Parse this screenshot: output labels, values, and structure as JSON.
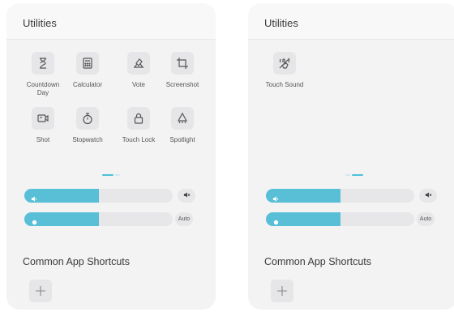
{
  "left": {
    "utilities_title": "Utilities",
    "tools": [
      {
        "label": "Countdown Day",
        "icon": "hourglass-icon"
      },
      {
        "label": "Calculator",
        "icon": "calculator-icon"
      },
      {
        "label": "Vote",
        "icon": "vote-icon"
      },
      {
        "label": "Screenshot",
        "icon": "crop-icon"
      },
      {
        "label": "Shot",
        "icon": "camera-icon"
      },
      {
        "label": "Stopwatch",
        "icon": "stopwatch-icon"
      },
      {
        "label": "Touch Lock",
        "icon": "lock-icon"
      },
      {
        "label": "Spotlight",
        "icon": "spotlight-icon"
      }
    ],
    "volume_level": 0.5,
    "brightness_level": 0.5,
    "mute_icon": "mute-icon",
    "auto_label": "Auto",
    "shortcuts_title": "Common App Shortcuts"
  },
  "right": {
    "utilities_title": "Utilities",
    "tools": [
      {
        "label": "Touch Sound",
        "icon": "touch-sound-icon"
      }
    ],
    "volume_level": 0.5,
    "brightness_level": 0.5,
    "mute_icon": "mute-icon",
    "auto_label": "Auto",
    "shortcuts_title": "Common App Shortcuts"
  },
  "colors": {
    "accent": "#58bfd6",
    "panel_bg": "#f3f3f4",
    "tile_bg": "#e6e6e8"
  }
}
